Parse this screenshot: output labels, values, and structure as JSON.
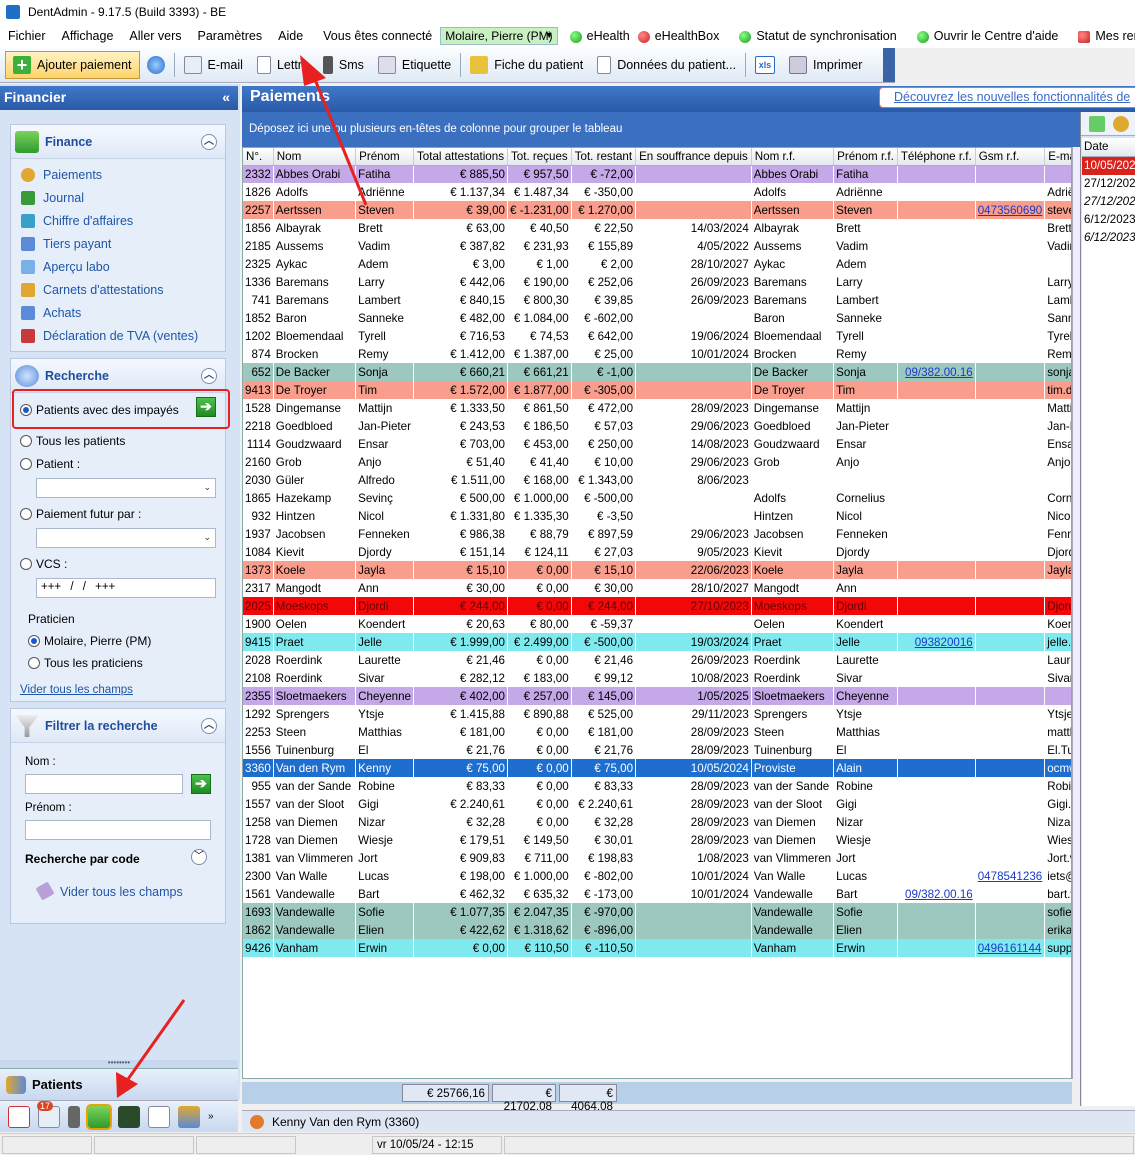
{
  "window": {
    "title": "DentAdmin - 9.17.5     (Build 3393) - BE"
  },
  "menu": {
    "items": [
      "Fichier",
      "Affichage",
      "Aller vers",
      "Paramètres",
      "Aide"
    ],
    "connected_label": "Vous êtes connecté",
    "user": "Molaire, Pierre (PM)",
    "ehealth": "eHealth",
    "ehealthbox": "eHealthBox",
    "sync": "Statut de synchronisation",
    "help_center": "Ouvrir le Centre d'aide",
    "mes_rend": "Mes rend"
  },
  "toolbar": {
    "add_payment": "Ajouter paiement",
    "email": "E-mail",
    "letter": "Lettre",
    "sms": "Sms",
    "label": "Etiquette",
    "patient_file": "Fiche du patient",
    "patient_data": "Données du patient...",
    "xls": "xls",
    "print": "Imprimer"
  },
  "left": {
    "header": "Financier",
    "collapse": "«",
    "finance": {
      "title": "Finance",
      "items": [
        "Paiements",
        "Journal",
        "Chiffre d'affaires",
        "Tiers payant",
        "Aperçu labo",
        "Carnets d'attestations",
        "Achats",
        "Déclaration de TVA (ventes)"
      ]
    },
    "search": {
      "title": "Recherche",
      "opt_unpaid": "Patients avec des impayés",
      "opt_all": "Tous les patients",
      "opt_patient": "Patient :",
      "opt_future": "Paiement futur par :",
      "opt_vcs": "VCS :",
      "vcs_value": "+++ / / +++",
      "practitioner_label": "Praticien",
      "pract_molaire": "Molaire, Pierre (PM)",
      "pract_all": "Tous les praticiens",
      "clear": "Vider tous les champs"
    },
    "filter": {
      "title": "Filtrer la recherche",
      "name_label": "Nom :",
      "firstname_label": "Prénom :",
      "code_search": "Recherche par code",
      "clear": "Vider tous les champs"
    },
    "patients_label": "Patients",
    "badge": "17"
  },
  "main": {
    "title": "Paiements",
    "promo": "Découvrez les nouvelles fonctionnalités de",
    "group_hint": "Déposez ici une ou plusieurs en-têtes de colonne pour grouper le tableau",
    "columns": [
      "N°.",
      "Nom",
      "Prénom",
      "Total attestations",
      "Tot. reçues",
      "Tot. restant",
      "En souffrance depuis",
      "Nom r.f.",
      "Prénom r.f.",
      "Téléphone r.f.",
      "Gsm r.f.",
      "E-mail r.f."
    ],
    "rows": [
      {
        "c": "purple",
        "v": [
          "2332",
          "Abbes Orabi",
          "Fatiha",
          "€ 885,50",
          "€ 957,50",
          "€ -72,00",
          "",
          "Abbes Orabi",
          "Fatiha",
          "",
          "",
          ""
        ]
      },
      {
        "c": "white",
        "v": [
          "1826",
          "Adolfs",
          "Adriënne",
          "€ 1.137,34",
          "€ 1.487,34",
          "€ -350,00",
          "",
          "Adolfs",
          "Adriënne",
          "",
          "",
          "Adriënne.Ado"
        ]
      },
      {
        "c": "salmon",
        "v": [
          "2257",
          "Aertssen",
          "Steven",
          "€ 39,00",
          "€ -1.231,00",
          "€ 1.270,00",
          "",
          "Aertssen",
          "Steven",
          "",
          "0473560690",
          "steven.aertss"
        ]
      },
      {
        "c": "white",
        "v": [
          "1856",
          "Albayrak",
          "Brett",
          "€ 63,00",
          "€ 40,50",
          "€ 22,50",
          "14/03/2024",
          "Albayrak",
          "Brett",
          "",
          "",
          "Brett.Albayrak"
        ]
      },
      {
        "c": "white",
        "v": [
          "2185",
          "Aussems",
          "Vadim",
          "€ 387,82",
          "€ 231,93",
          "€ 155,89",
          "4/05/2022",
          "Aussems",
          "Vadim",
          "",
          "",
          "Vadim.Aussem"
        ]
      },
      {
        "c": "white",
        "v": [
          "2325",
          "Aykac",
          "Adem",
          "€ 3,00",
          "€ 1,00",
          "€ 2,00",
          "28/10/2027",
          "Aykac",
          "Adem",
          "",
          "",
          ""
        ]
      },
      {
        "c": "white",
        "v": [
          "1336",
          "Baremans",
          "Larry",
          "€ 442,06",
          "€ 190,00",
          "€ 252,06",
          "26/09/2023",
          "Baremans",
          "Larry",
          "",
          "",
          "Larry.Bareman"
        ]
      },
      {
        "c": "white",
        "v": [
          "741",
          "Baremans",
          "Lambert",
          "€ 840,15",
          "€ 800,30",
          "€ 39,85",
          "26/09/2023",
          "Baremans",
          "Lambert",
          "",
          "",
          "Lambert.Baren"
        ]
      },
      {
        "c": "white",
        "v": [
          "1852",
          "Baron",
          "Sanneke",
          "€ 482,00",
          "€ 1.084,00",
          "€ -602,00",
          "",
          "Baron",
          "Sanneke",
          "",
          "",
          "Sanneke.Baro"
        ]
      },
      {
        "c": "white",
        "v": [
          "1202",
          "Bloemendaal",
          "Tyrell",
          "€ 716,53",
          "€ 74,53",
          "€ 642,00",
          "19/06/2024",
          "Bloemendaal",
          "Tyrell",
          "",
          "",
          "Tyrell.Bloeme"
        ]
      },
      {
        "c": "white",
        "v": [
          "874",
          "Brocken",
          "Remy",
          "€ 1.412,00",
          "€ 1.387,00",
          "€ 25,00",
          "10/01/2024",
          "Brocken",
          "Remy",
          "",
          "",
          "Remy.Brocken"
        ]
      },
      {
        "c": "teal",
        "v": [
          "652",
          "De Backer",
          "Sonja",
          "€ 660,21",
          "€ 661,21",
          "€ -1,00",
          "",
          "De Backer",
          "Sonja",
          "09/382.00.16",
          "",
          "sonja.de.back"
        ]
      },
      {
        "c": "salmon",
        "v": [
          "9413",
          "De Troyer",
          "Tim",
          "€ 1.572,00",
          "€ 1.877,00",
          "€ -305,00",
          "",
          "De Troyer",
          "Tim",
          "",
          "",
          "tim.detroyer@"
        ]
      },
      {
        "c": "white",
        "v": [
          "1528",
          "Dingemanse",
          "Mattijn",
          "€ 1.333,50",
          "€ 861,50",
          "€ 472,00",
          "28/09/2023",
          "Dingemanse",
          "Mattijn",
          "",
          "",
          "Mattijn.Dinger"
        ]
      },
      {
        "c": "white",
        "v": [
          "2218",
          "Goedbloed",
          "Jan-Pieter",
          "€ 243,53",
          "€ 186,50",
          "€ 57,03",
          "29/06/2023",
          "Goedbloed",
          "Jan-Pieter",
          "",
          "",
          "Jan-Pieter.Go"
        ]
      },
      {
        "c": "white",
        "v": [
          "1114",
          "Goudzwaard",
          "Ensar",
          "€ 703,00",
          "€ 453,00",
          "€ 250,00",
          "14/08/2023",
          "Goudzwaard",
          "Ensar",
          "",
          "",
          "Ensar.Goudzw"
        ]
      },
      {
        "c": "white",
        "v": [
          "2160",
          "Grob",
          "Anjo",
          "€ 51,40",
          "€ 41,40",
          "€ 10,00",
          "29/06/2023",
          "Grob",
          "Anjo",
          "",
          "",
          "Anjo.Grob@m"
        ]
      },
      {
        "c": "white",
        "v": [
          "2030",
          "Güler",
          "Alfredo",
          "€ 1.511,00",
          "€ 168,00",
          "€ 1.343,00",
          "8/06/2023",
          "",
          "",
          "",
          "",
          ""
        ]
      },
      {
        "c": "white",
        "v": [
          "1865",
          "Hazekamp",
          "Sevinç",
          "€ 500,00",
          "€ 1.000,00",
          "€ -500,00",
          "",
          "Adolfs",
          "Cornelius",
          "",
          "",
          "Cornelius.Ado"
        ]
      },
      {
        "c": "white",
        "v": [
          "932",
          "Hintzen",
          "Nicol",
          "€ 1.331,80",
          "€ 1.335,30",
          "€ -3,50",
          "",
          "Hintzen",
          "Nicol",
          "",
          "",
          "Nicol.Hintzen@"
        ]
      },
      {
        "c": "white",
        "v": [
          "1937",
          "Jacobsen",
          "Fenneken",
          "€ 986,38",
          "€ 88,79",
          "€ 897,59",
          "29/06/2023",
          "Jacobsen",
          "Fenneken",
          "",
          "",
          "Fenneken.Jac"
        ]
      },
      {
        "c": "white",
        "v": [
          "1084",
          "Kievit",
          "Djordy",
          "€ 151,14",
          "€ 124,11",
          "€ 27,03",
          "9/05/2023",
          "Kievit",
          "Djordy",
          "",
          "",
          "Djordy.Kievit@"
        ]
      },
      {
        "c": "salmon",
        "v": [
          "1373",
          "Koele",
          "Jayla",
          "€ 15,10",
          "€ 0,00",
          "€ 15,10",
          "22/06/2023",
          "Koele",
          "Jayla",
          "",
          "",
          "Jayla.Koele@"
        ]
      },
      {
        "c": "white",
        "v": [
          "2317",
          "Mangodt",
          "Ann",
          "€ 30,00",
          "€ 0,00",
          "€ 30,00",
          "28/10/2027",
          "Mangodt",
          "Ann",
          "",
          "",
          ""
        ]
      },
      {
        "c": "red",
        "v": [
          "2025",
          "Moeskops",
          "Djordi",
          "€ 244,00",
          "€ 0,00",
          "€ 244,00",
          "27/10/2023",
          "Moeskops",
          "Djordi",
          "",
          "",
          "Djordi.Moesk"
        ]
      },
      {
        "c": "white",
        "v": [
          "1900",
          "Oelen",
          "Koendert",
          "€ 20,63",
          "€ 80,00",
          "€ -59,37",
          "",
          "Oelen",
          "Koendert",
          "",
          "",
          "Koendert.Oele"
        ]
      },
      {
        "c": "cyan",
        "v": [
          "9415",
          "Praet",
          "Jelle",
          "€ 1.999,00",
          "€ 2.499,00",
          "€ -500,00",
          "19/03/2024",
          "Praet",
          "Jelle",
          "093820016",
          "",
          "jelle.praet@c"
        ]
      },
      {
        "c": "white",
        "v": [
          "2028",
          "Roerdink",
          "Laurette",
          "€ 21,46",
          "€ 0,00",
          "€ 21,46",
          "26/09/2023",
          "Roerdink",
          "Laurette",
          "",
          "",
          "Laurette.Roer"
        ]
      },
      {
        "c": "white",
        "v": [
          "2108",
          "Roerdink",
          "Sivar",
          "€ 282,12",
          "€ 183,00",
          "€ 99,12",
          "10/08/2023",
          "Roerdink",
          "Sivar",
          "",
          "",
          "Sivar.Roerdin"
        ]
      },
      {
        "c": "purple",
        "v": [
          "2355",
          "Sloetmaekers",
          "Cheyenne",
          "€ 402,00",
          "€ 257,00",
          "€ 145,00",
          "1/05/2025",
          "Sloetmaekers",
          "Cheyenne",
          "",
          "",
          ""
        ]
      },
      {
        "c": "white",
        "v": [
          "1292",
          "Sprengers",
          "Ytsje",
          "€ 1.415,88",
          "€ 890,88",
          "€ 525,00",
          "29/11/2023",
          "Sprengers",
          "Ytsje",
          "",
          "",
          "Ytsje.Sprenge"
        ]
      },
      {
        "c": "white",
        "v": [
          "2253",
          "Steen",
          "Matthias",
          "€ 181,00",
          "€ 0,00",
          "€ 181,00",
          "28/09/2023",
          "Steen",
          "Matthias",
          "",
          "",
          "matthias@atx"
        ]
      },
      {
        "c": "white",
        "v": [
          "1556",
          "Tuinenburg",
          "El",
          "€ 21,76",
          "€ 0,00",
          "€ 21,76",
          "28/09/2023",
          "Tuinenburg",
          "El",
          "",
          "",
          "El.Tuinenburg"
        ]
      },
      {
        "c": "sel",
        "v": [
          "3360",
          "Van den Rym",
          "Kenny",
          "€ 75,00",
          "€ 0,00",
          "€ 75,00",
          "10/05/2024",
          "Proviste",
          "Alain",
          "",
          "",
          "ocmwgent@d"
        ]
      },
      {
        "c": "white",
        "v": [
          "955",
          "van der Sande",
          "Robine",
          "€ 83,33",
          "€ 0,00",
          "€ 83,33",
          "28/09/2023",
          "van der Sande",
          "Robine",
          "",
          "",
          "Robine.van.de"
        ]
      },
      {
        "c": "white",
        "v": [
          "1557",
          "van der Sloot",
          "Gigi",
          "€ 2.240,61",
          "€ 0,00",
          "€ 2.240,61",
          "28/09/2023",
          "van der Sloot",
          "Gigi",
          "",
          "",
          "Gigi.van der S"
        ]
      },
      {
        "c": "white",
        "v": [
          "1258",
          "van Diemen",
          "Nizar",
          "€ 32,28",
          "€ 0,00",
          "€ 32,28",
          "28/09/2023",
          "van Diemen",
          "Nizar",
          "",
          "",
          "Nizar.van.Die"
        ]
      },
      {
        "c": "white",
        "v": [
          "1728",
          "van Diemen",
          "Wiesje",
          "€ 179,51",
          "€ 149,50",
          "€ 30,01",
          "28/09/2023",
          "van Diemen",
          "Wiesje",
          "",
          "",
          "Wiesje.van Di"
        ]
      },
      {
        "c": "white",
        "v": [
          "1381",
          "van Vlimmeren",
          "Jort",
          "€ 909,83",
          "€ 711,00",
          "€ 198,83",
          "1/08/2023",
          "van Vlimmeren",
          "Jort",
          "",
          "",
          "Jort.van Vlim"
        ]
      },
      {
        "c": "white",
        "v": [
          "2300",
          "Van Walle",
          "Lucas",
          "€ 198,00",
          "€ 1.000,00",
          "€ -802,00",
          "10/01/2024",
          "Van Walle",
          "Lucas",
          "",
          "0478541236",
          "iets@dentadm"
        ]
      },
      {
        "c": "white",
        "v": [
          "1561",
          "Vandewalle",
          "Bart",
          "€ 462,32",
          "€ 635,32",
          "€ -173,00",
          "10/01/2024",
          "Vandewalle",
          "Bart",
          "09/382.00.16",
          "",
          "bart.vandewa"
        ]
      },
      {
        "c": "teal",
        "v": [
          "1693",
          "Vandewalle",
          "Sofie",
          "€ 1.077,35",
          "€ 2.047,35",
          "€ -970,00",
          "",
          "Vandewalle",
          "Sofie",
          "",
          "",
          "sofie.vandewa"
        ]
      },
      {
        "c": "teal",
        "v": [
          "1862",
          "Vandewalle",
          "Elien",
          "€ 422,62",
          "€ 1.318,62",
          "€ -896,00",
          "",
          "Vandewalle",
          "Elien",
          "",
          "",
          "erika.vandewa"
        ]
      },
      {
        "c": "cyan",
        "v": [
          "9426",
          "Vanham",
          "Erwin",
          "€ 0,00",
          "€ 110,50",
          "€ -110,50",
          "",
          "Vanham",
          "Erwin",
          "",
          "0496161144",
          "support@atx."
        ]
      }
    ],
    "totals": [
      "€ 25766,16",
      "€ 21702,08",
      "€ 4064,08"
    ]
  },
  "right_panel": {
    "header": "Date",
    "dates": [
      "10/05/2024",
      "27/12/2023",
      "27/12/2023",
      "6/12/2023",
      "6/12/2023"
    ]
  },
  "current_patient": "Kenny Van den Rym (3360)",
  "status": {
    "datetime": "vr 10/05/24 - 12:15"
  },
  "colors": {
    "accent": "#2a5aa8",
    "selected_row": "#1e6ed0",
    "annotation": "#e82020"
  }
}
